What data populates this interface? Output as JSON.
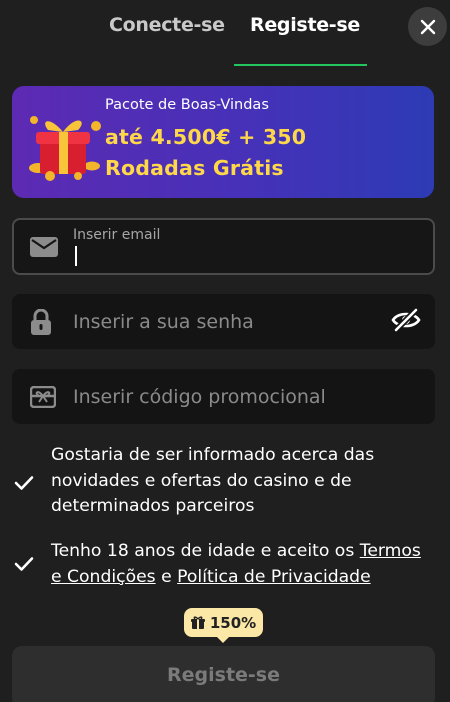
{
  "tabs": {
    "login_label": "Conecte-se",
    "register_label": "Registe-se",
    "active": "register",
    "accent_color": "#22c55e"
  },
  "close": {
    "icon": "close-icon"
  },
  "banner": {
    "icon": "gift-box-icon",
    "small_text": "Pacote de Boas-Vindas",
    "big_line1": "até 4.500€ + 350",
    "big_line2": "Rodadas Grátis",
    "highlight_color": "#ffd84a"
  },
  "form": {
    "email": {
      "icon": "envelope-icon",
      "label": "Inserir email",
      "value": ""
    },
    "password": {
      "icon": "lock-icon",
      "placeholder": "Inserir a sua senha",
      "toggle_icon": "eye-slash-icon"
    },
    "promo": {
      "icon": "gift-card-icon",
      "placeholder": "Inserir código promocional"
    }
  },
  "consents": {
    "marketing": {
      "checked": true,
      "text": "Gostaria de ser informado acerca das novidades e ofertas do casino e de determinados parceiros"
    },
    "terms": {
      "checked": true,
      "prefix": "Tenho 18 anos de idade e aceito os ",
      "terms_link": "Termos e Condições",
      "joiner": " e ",
      "privacy_link": "Política de Privacidade"
    }
  },
  "bonus_badge": {
    "icon": "gift-icon",
    "text": "150%"
  },
  "submit": {
    "label": "Registe-se"
  }
}
